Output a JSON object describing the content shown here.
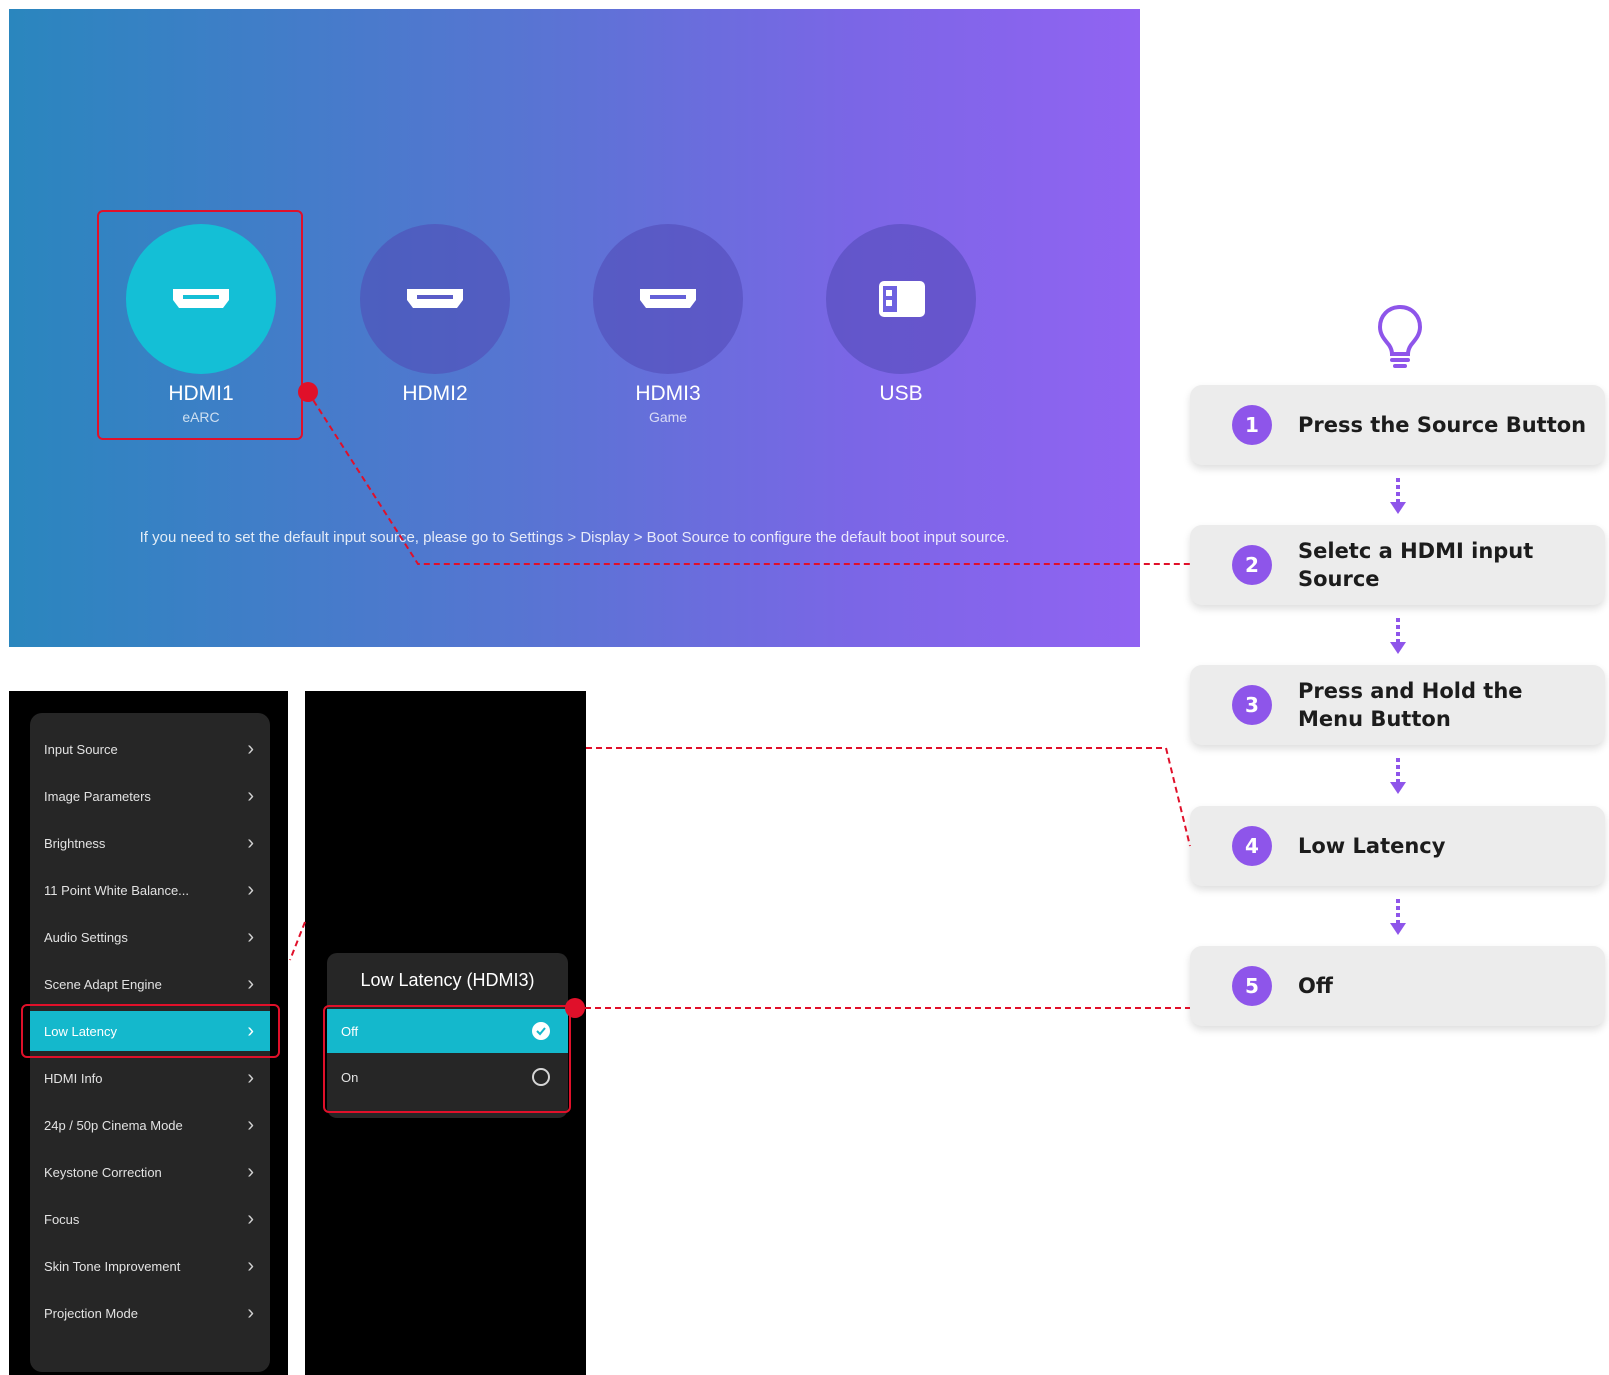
{
  "source_screen": {
    "sources": [
      {
        "label": "HDMI1",
        "sub": "eARC",
        "icon": "hdmi-port-icon",
        "selected": true
      },
      {
        "label": "HDMI2",
        "sub": "",
        "icon": "hdmi-port-icon",
        "selected": false
      },
      {
        "label": "HDMI3",
        "sub": "Game",
        "icon": "hdmi-port-icon",
        "selected": false
      },
      {
        "label": "USB",
        "sub": "",
        "icon": "usb-drive-icon",
        "selected": false
      }
    ],
    "hint": "If you need to set the default input source, please go to Settings > Display > Boot Source to configure the default boot input source.",
    "colors": {
      "active_source": "#14bfd6",
      "gradient_start": "#2a86be",
      "gradient_end": "#9163f2"
    }
  },
  "menu": {
    "items": [
      {
        "label": "Input Source"
      },
      {
        "label": "Image Parameters"
      },
      {
        "label": "Brightness"
      },
      {
        "label": "11 Point White Balance..."
      },
      {
        "label": "Audio Settings"
      },
      {
        "label": "Scene Adapt Engine"
      },
      {
        "label": "Low Latency",
        "active": true
      },
      {
        "label": "HDMI Info"
      },
      {
        "label": "24p / 50p Cinema Mode"
      },
      {
        "label": "Keystone Correction"
      },
      {
        "label": "Focus"
      },
      {
        "label": "Skin Tone Improvement"
      },
      {
        "label": "Projection Mode"
      }
    ]
  },
  "submenu": {
    "title": "Low Latency (HDMI3)",
    "options": [
      {
        "label": "Off",
        "checked": true
      },
      {
        "label": "On",
        "checked": false
      }
    ]
  },
  "steps": [
    {
      "number": "1",
      "text": "Press the Source Button"
    },
    {
      "number": "2",
      "text": "Seletc a HDMI input Source"
    },
    {
      "number": "3",
      "text": "Press and Hold the Menu Button"
    },
    {
      "number": "4",
      "text": "Low Latency"
    },
    {
      "number": "5",
      "text": "Off"
    }
  ],
  "colors": {
    "highlight": "#e0102a",
    "step_badge": "#8e55ea",
    "menu_active": "#14b8cc"
  }
}
